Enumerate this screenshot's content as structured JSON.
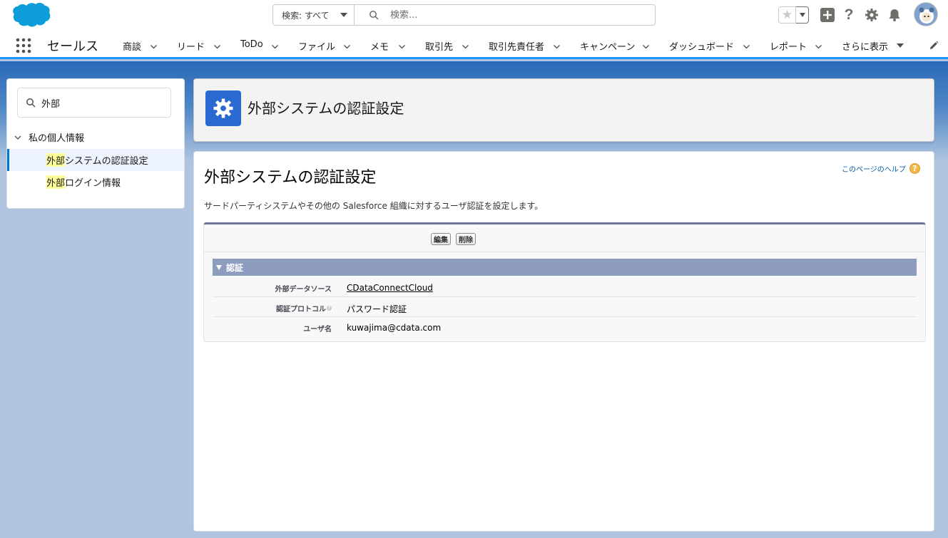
{
  "header": {
    "search_scope": "検索: すべて",
    "search_placeholder": "検索..."
  },
  "nav": {
    "app_name": "セールス",
    "items": [
      {
        "label": "商談"
      },
      {
        "label": "リード"
      },
      {
        "label": "ToDo"
      },
      {
        "label": "ファイル"
      },
      {
        "label": "メモ"
      },
      {
        "label": "取引先"
      },
      {
        "label": "取引先責任者"
      },
      {
        "label": "キャンペーン"
      },
      {
        "label": "ダッシュボード"
      },
      {
        "label": "レポート"
      }
    ],
    "more_label": "さらに表示"
  },
  "sidebar": {
    "quickfind_value": "外部",
    "parent_label": "私の個人情報",
    "items": [
      {
        "highlight": "外部",
        "rest": "システムの認証設定",
        "active": true
      },
      {
        "highlight": "外部",
        "rest": "ログイン情報",
        "active": false
      }
    ]
  },
  "page_header": {
    "title": "外部システムの認証設定"
  },
  "content": {
    "title": "外部システムの認証設定",
    "help_link": "このページのヘルプ",
    "description": "サードパーティシステムやその他の Salesforce 組織に対するユーザ認証を設定します。",
    "buttons": {
      "edit": "編集",
      "delete": "削除"
    },
    "section_title": "認証",
    "fields": [
      {
        "label": "外部データソース",
        "value": "CDataConnectCloud"
      },
      {
        "label": "認証プロトコル",
        "value": "パスワード認証"
      },
      {
        "label": "ユーザ名",
        "value": "kuwajima@cdata.com"
      }
    ]
  },
  "colors": {
    "brand_blue": "#0176d3",
    "section_header": "#8e9dbf",
    "page_icon_bg": "#2a69cf"
  }
}
